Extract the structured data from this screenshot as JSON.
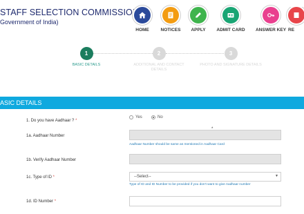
{
  "header": {
    "org_title": "STAFF SELECTION COMMISSION",
    "org_subtitle": "Government of India)"
  },
  "nav": {
    "items": [
      {
        "label": "HOME",
        "icon": "home-icon",
        "color": "#2b4a9b"
      },
      {
        "label": "NOTICES",
        "icon": "notices-icon",
        "color": "#f39c12"
      },
      {
        "label": "APPLY",
        "icon": "apply-icon",
        "color": "#3fb44d"
      },
      {
        "label": "ADMIT CARD",
        "icon": "admit-card-icon",
        "color": "#1aa574"
      },
      {
        "label": "ANSWER KEY",
        "icon": "answer-key-icon",
        "color": "#e9408f"
      },
      {
        "label": "RE",
        "icon": "result-icon",
        "color": "#e8454a"
      }
    ]
  },
  "steps": {
    "items": [
      {
        "number": "1",
        "label": "BASIC DETAILS",
        "active": true
      },
      {
        "number": "2",
        "label": "ADDITIONAL AND CONTACT DETAILS",
        "active": false
      },
      {
        "number": "3",
        "label": "PHOTO AND SIGNATURE DETAILS",
        "active": false
      }
    ],
    "active_color": "#1b7d5e",
    "inactive_color": "#d9d9d9"
  },
  "section": {
    "title": "ASIC DETAILS",
    "color": "#0fa9df"
  },
  "form": {
    "q1": {
      "label": "1. Do you have Aadhaar ?",
      "required": "*",
      "yes": "Yes",
      "no": "No",
      "selected": "No"
    },
    "q1a": {
      "label": "1a. Aadhaar Number",
      "value": "",
      "star": "*",
      "hint": "Aadhaar Number should be same as mentioned in Aadhaar Card"
    },
    "q1b": {
      "label": "1b. Verify Aadhaar Number",
      "value": ""
    },
    "q1c": {
      "label": "1c. Type of ID",
      "required": "*",
      "selected": "--Select--",
      "hint": "Type of ID and ID Number to be provided if you don't want to give Aadhaar number"
    },
    "q1d": {
      "label": "1d. ID Number",
      "required": "*",
      "value": ""
    }
  }
}
